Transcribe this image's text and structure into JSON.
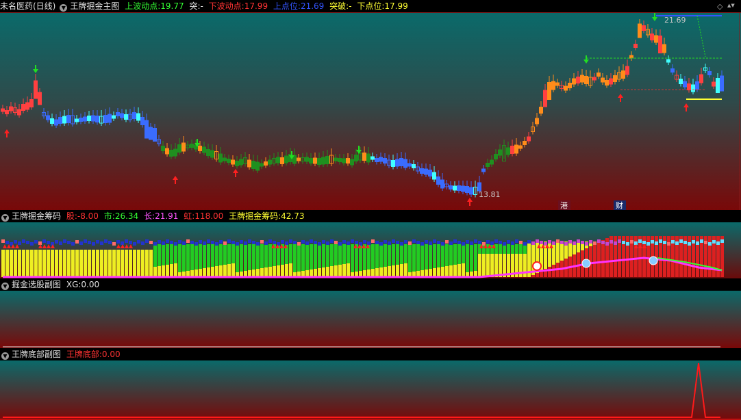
{
  "main": {
    "stock_name": "未名医药(日线)",
    "indicator_name": "王牌掘金主图",
    "up_label": "上波动点:",
    "up_value": "19.77",
    "breakout_label": "突:",
    "breakout_value": "-",
    "down_label": "下波动点:",
    "down_value": "17.99",
    "top_label": "上点位:",
    "top_value": "21.69",
    "breakout2_label": "突破:",
    "breakout2_value": "-",
    "bottom_label": "下点位:",
    "bottom_value": "17.99",
    "high_annotation": "21.69",
    "low_annotation": "13.81",
    "marker_hk": "港",
    "marker_cai": "财",
    "colors": {
      "up": "#ff4040",
      "down_light": "#40ffff",
      "blue": "#3a6cff",
      "green": "#1f8f1f",
      "orange": "#ff8c1a"
    }
  },
  "chips": {
    "title": "王牌掘金筹码",
    "gu_label": "股:",
    "gu_value": "-8.00",
    "shi_label": "市:",
    "shi_value": "26.34",
    "chang_label": "长:",
    "chang_value": "21.91",
    "hong_label": "虹:",
    "hong_value": "118.00",
    "chips_label": "王牌掘金筹码:",
    "chips_value": "42.73"
  },
  "select": {
    "title": "掘金选股副图",
    "xg_label": "XG:",
    "xg_value": "0.00"
  },
  "bottom": {
    "title": "王牌底部副图",
    "bottom_label": "王牌底部:",
    "bottom_value": "0.00"
  },
  "window_controls": {
    "diamond_icon": "◇",
    "updown_icon": "▲▼"
  }
}
